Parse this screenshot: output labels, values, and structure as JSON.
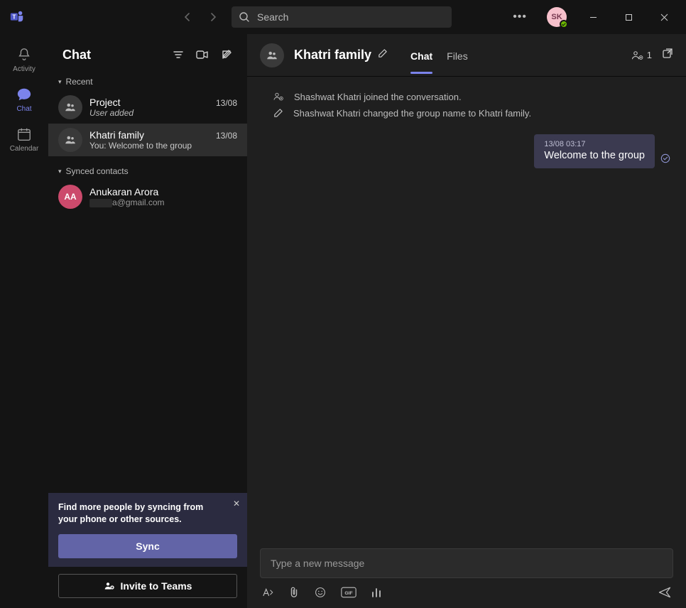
{
  "titlebar": {
    "search_placeholder": "Search",
    "avatar_initials": "SK"
  },
  "rail": {
    "items": [
      {
        "label": "Activity"
      },
      {
        "label": "Chat"
      },
      {
        "label": "Calendar"
      }
    ]
  },
  "leftpanel": {
    "title": "Chat",
    "sections": {
      "recent": "Recent",
      "synced": "Synced contacts"
    },
    "chats": [
      {
        "name": "Project",
        "date": "13/08",
        "preview": "User added"
      },
      {
        "name": "Khatri family",
        "date": "13/08",
        "preview": "You: Welcome to the group"
      }
    ],
    "contacts": [
      {
        "name": "Anukaran Arora",
        "initials": "AA",
        "email_suffix": "a@gmail.com"
      }
    ],
    "sync_card": {
      "text": "Find more people by syncing from your phone or other sources.",
      "button": "Sync"
    },
    "invite_button": "Invite to Teams"
  },
  "conversation": {
    "title": "Khatri family",
    "tabs": {
      "chat": "Chat",
      "files": "Files"
    },
    "participant_count": "1",
    "system_events": [
      "Shashwat Khatri joined the conversation.",
      "Shashwat Khatri changed the group name to Khatri family."
    ],
    "messages": [
      {
        "timestamp": "13/08 03:17",
        "text": "Welcome to the group"
      }
    ],
    "composer_placeholder": "Type a new message"
  }
}
